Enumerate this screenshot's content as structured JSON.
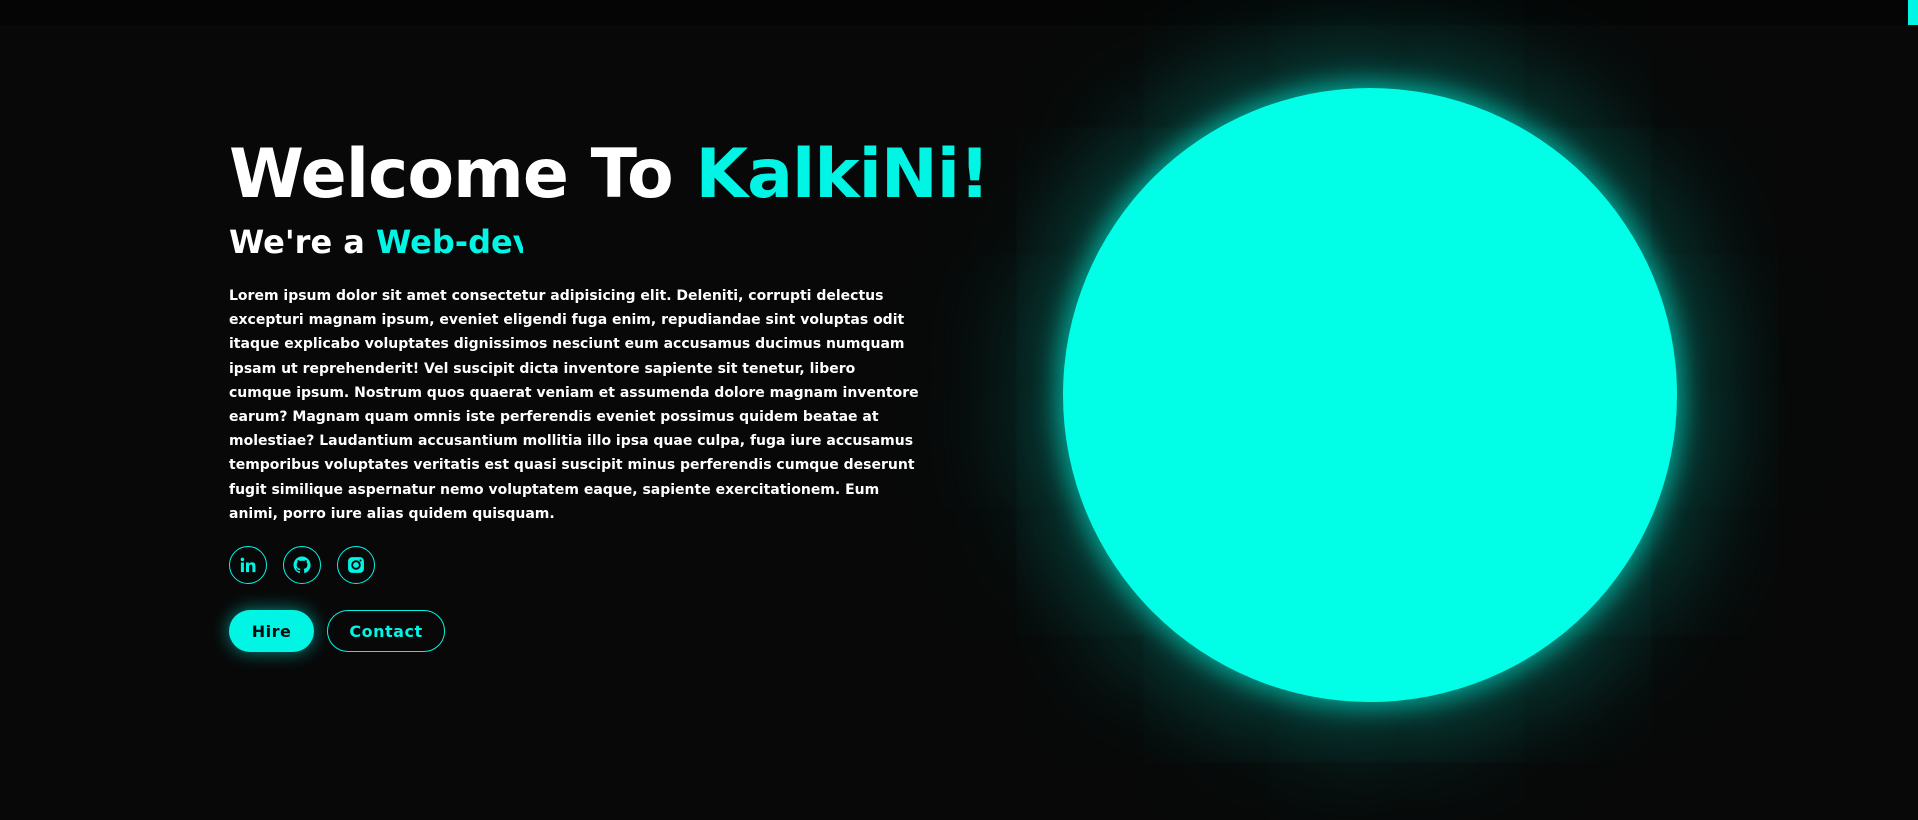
{
  "hero": {
    "title_main": "Welcome To",
    "title_accent": "KalkiNi!",
    "subtitle_prefix": "We're a",
    "subtitle_typed": "Web-dev",
    "description": "Lorem ipsum dolor sit amet consectetur adipisicing elit. Deleniti, corrupti delectus excepturi magnam ipsum, eveniet eligendi fuga enim, repudiandae sint voluptas odit itaque explicabo voluptates dignissimos nesciunt eum accusamus ducimus numquam ipsam ut reprehenderit! Vel suscipit dicta inventore sapiente sit tenetur, libero cumque ipsum. Nostrum quos quaerat veniam et assumenda dolore magnam inventore earum? Magnam quam omnis iste perferendis eveniet possimus quidem beatae at molestiae? Laudantium accusantium mollitia illo ipsa quae culpa, fuga iure accusamus temporibus voluptates veritatis est quasi suscipit minus perferendis cumque deserunt fugit similique aspernatur nemo voluptatem eaque, sapiente exercitationem. Eum animi, porro iure alias quidem quisquam."
  },
  "socials": [
    {
      "icon": "linkedin-icon"
    },
    {
      "icon": "github-icon"
    },
    {
      "icon": "instagram-icon"
    }
  ],
  "actions": {
    "hire_label": "Hire",
    "contact_label": "Contact"
  },
  "colors": {
    "accent": "#00f5e4",
    "background": "#080808",
    "text": "#ffffff"
  }
}
